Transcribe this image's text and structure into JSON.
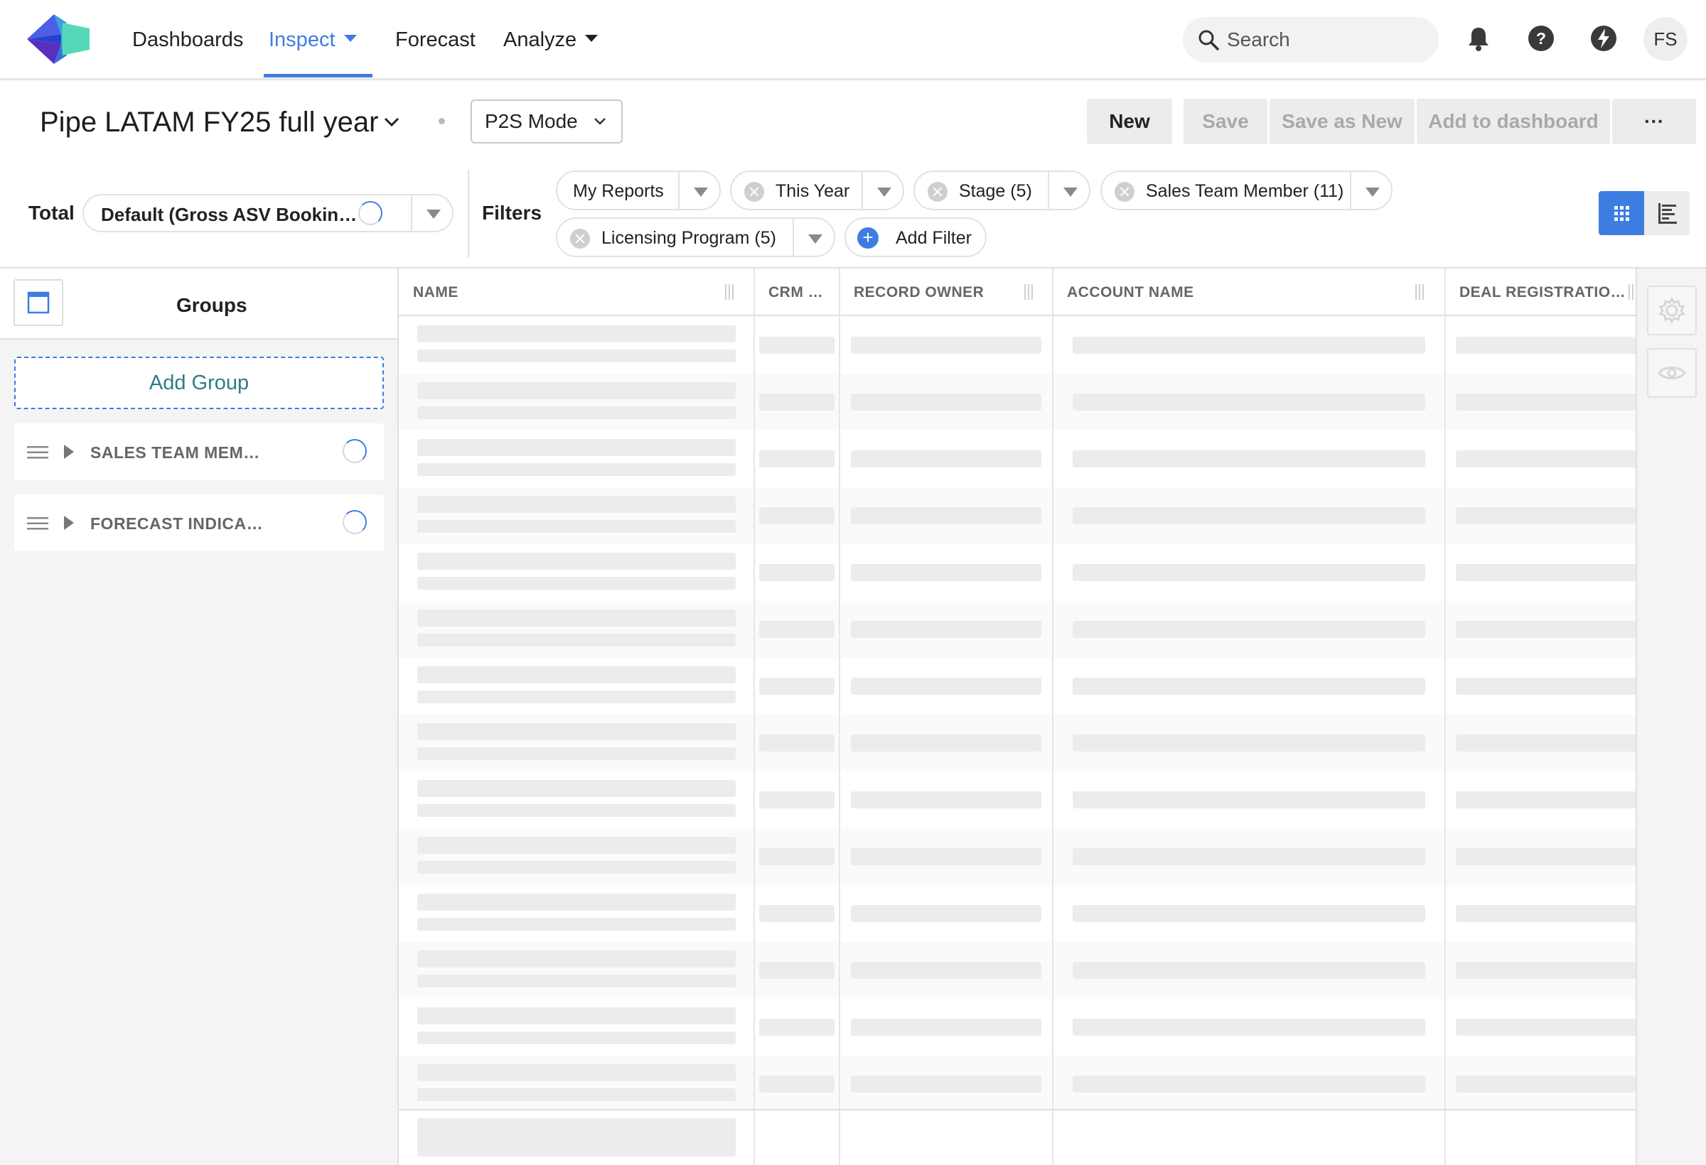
{
  "nav": {
    "items": [
      {
        "label": "Dashboards"
      },
      {
        "label": "Inspect"
      },
      {
        "label": "Forecast"
      },
      {
        "label": "Analyze"
      }
    ],
    "search_placeholder": "Search",
    "avatar_initials": "FS"
  },
  "report": {
    "title": "Pipe LATAM FY25 full year",
    "mode": "P2S Mode",
    "buttons": {
      "new": "New",
      "save": "Save",
      "save_as_new": "Save as New",
      "add_to_dashboard": "Add to dashboard",
      "more": "···"
    }
  },
  "total": {
    "label": "Total",
    "value": "Default (Gross ASV Bookin…"
  },
  "filters": {
    "label": "Filters",
    "chips": [
      {
        "label": "My Reports"
      },
      {
        "label": "This Year"
      },
      {
        "label": "Stage (5)"
      },
      {
        "label": "Sales Team Member (11)"
      },
      {
        "label": "Licensing Program (5)"
      }
    ],
    "add_filter": "Add Filter"
  },
  "groups": {
    "title": "Groups",
    "add_group": "Add Group",
    "items": [
      {
        "label": "SALES TEAM MEM…"
      },
      {
        "label": "FORECAST INDICA…"
      }
    ]
  },
  "table": {
    "columns": [
      {
        "label": "NAME"
      },
      {
        "label": "CRM …"
      },
      {
        "label": "RECORD OWNER"
      },
      {
        "label": "ACCOUNT NAME"
      },
      {
        "label": "DEAL REGISTRATIO…"
      }
    ],
    "loading_rows": 14
  },
  "colors": {
    "accent": "#3d7de2",
    "add_group_text": "#2c7e83",
    "skeleton": "#ececec",
    "panel_bg": "#f4f4f4"
  },
  "icons": [
    "app-logo-icon",
    "search-icon",
    "bell-icon",
    "help-icon",
    "lightning-icon",
    "panel-toggle-icon",
    "grid-view-icon",
    "list-view-icon",
    "settings-icon",
    "eye-icon",
    "drag-handle-icon"
  ]
}
